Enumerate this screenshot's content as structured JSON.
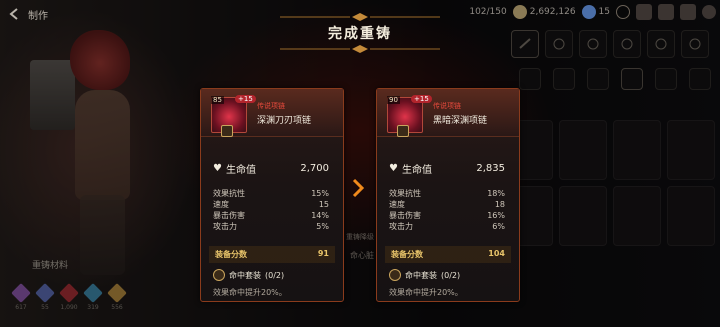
{
  "header": {
    "back_label": "制作",
    "title": "完成重铸"
  },
  "status": {
    "stamina": "102/150",
    "gold": "2,692,126",
    "gems": "15"
  },
  "materials": {
    "label": "重铸材料",
    "items": [
      {
        "count": "617",
        "color": "#a466c9"
      },
      {
        "count": "55",
        "color": "#6c7fd1"
      },
      {
        "count": "1,090",
        "color": "#c2373f"
      },
      {
        "count": "319",
        "color": "#4aa0c8"
      },
      {
        "count": "556",
        "color": "#d4a34a"
      }
    ]
  },
  "before": {
    "level": "85",
    "plus": "+15",
    "rarity": "传说项链",
    "name": "深渊刀刃项链",
    "hp_label": "生命值",
    "hp_value": "2,700",
    "subs": [
      {
        "label": "效果抗性",
        "value": "15%"
      },
      {
        "label": "速度",
        "value": "15"
      },
      {
        "label": "暴击伤害",
        "value": "14%"
      },
      {
        "label": "攻击力",
        "value": "5%"
      }
    ],
    "score_label": "装备分数",
    "score": "91",
    "set_name": "命中套装",
    "set_count": "(0/2)",
    "set_desc": "效果命中提升20%。"
  },
  "after": {
    "level": "90",
    "plus": "+15",
    "rarity": "传说项链",
    "name": "黑暗深渊项链",
    "hp_label": "生命值",
    "hp_value": "2,835",
    "subs": [
      {
        "label": "效果抗性",
        "value": "18%"
      },
      {
        "label": "速度",
        "value": "18"
      },
      {
        "label": "暴击伤害",
        "value": "16%"
      },
      {
        "label": "攻击力",
        "value": "6%"
      }
    ],
    "score_label": "装备分数",
    "score": "104",
    "set_name": "命中套装",
    "set_count": "(0/2)",
    "set_desc": "效果命中提升20%。"
  },
  "background_labels": {
    "left": "重铸降级",
    "center": "命心脏"
  },
  "accent": {
    "rarity": "#e74a3c",
    "score": "#e8c46a",
    "arrow": "#f08a1c",
    "border": "#8a3b1c"
  }
}
